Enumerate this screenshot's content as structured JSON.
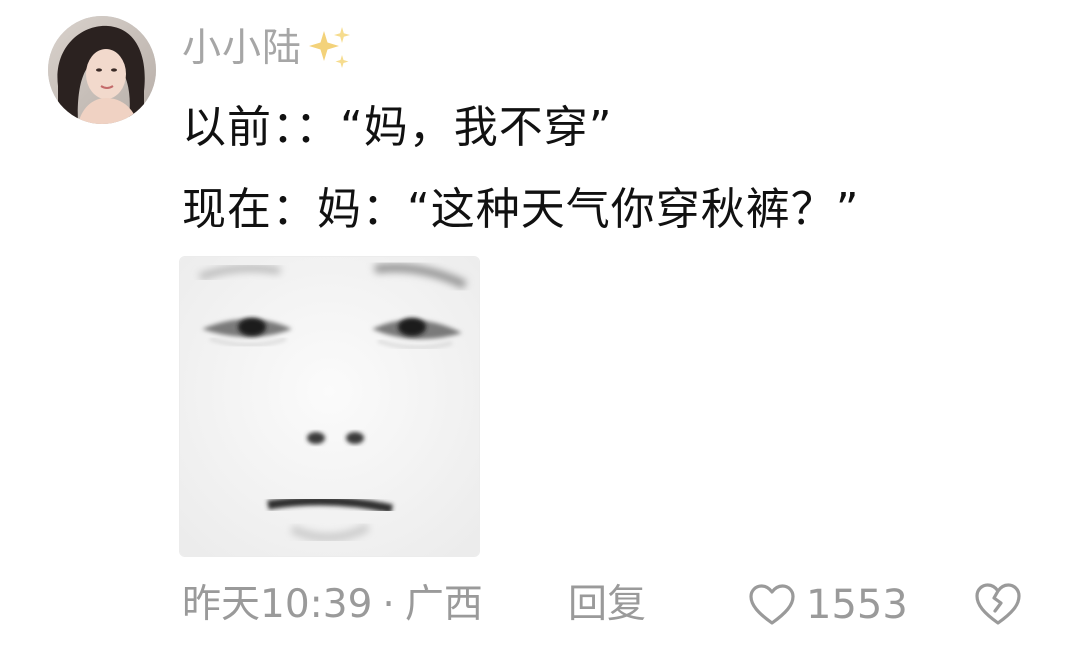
{
  "comment": {
    "username": "小小陆",
    "username_icon": "sparkles-icon",
    "avatar_icon": "user-avatar",
    "text_lines": [
      "以前：：“妈，我不穿”",
      "现在：妈：“这种天气你穿秋裤？”"
    ],
    "image_icon": "blank-stare-meme-face",
    "timestamp": "昨天10:39",
    "separator": "·",
    "location": "广西",
    "reply_label": "回复",
    "like_icon": "heart-outline-icon",
    "like_count": "1553",
    "dislike_icon": "broken-heart-icon"
  },
  "colors": {
    "primary_text": "#111111",
    "secondary_text": "#9a9a9a",
    "username": "#a6a6a6",
    "sparkle": "#f5d77a",
    "background": "#ffffff"
  }
}
